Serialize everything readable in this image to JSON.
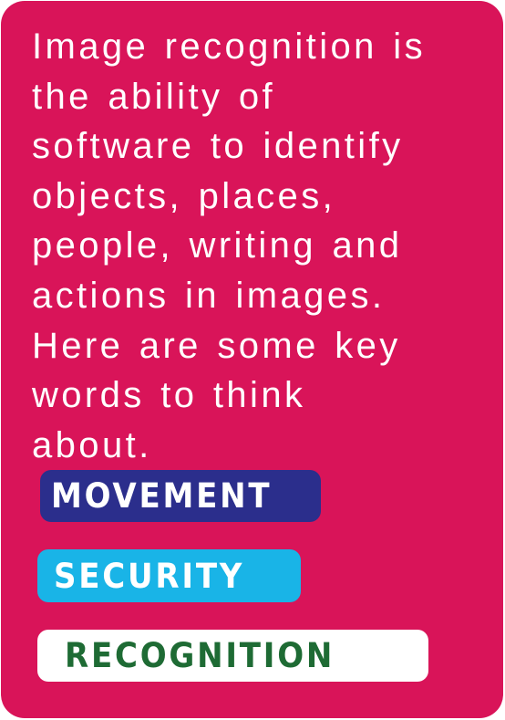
{
  "card": {
    "background": "#d91459",
    "intro_lines": [
      "Image recognition is",
      "the ability of",
      "software to identify",
      "objects, places,",
      "people, writing and",
      "actions in images.",
      "Here are some key",
      "words to think",
      "about."
    ]
  },
  "keywords": [
    {
      "label": "MOVEMENT",
      "background": "#2b2e8c",
      "text_color": "#ffffff"
    },
    {
      "label": "SECURITY",
      "background": "#19b4e7",
      "text_color": "#ffffff"
    },
    {
      "label": "RECOGNITION",
      "background": "#ffffff",
      "text_color": "#1e6b34"
    }
  ]
}
